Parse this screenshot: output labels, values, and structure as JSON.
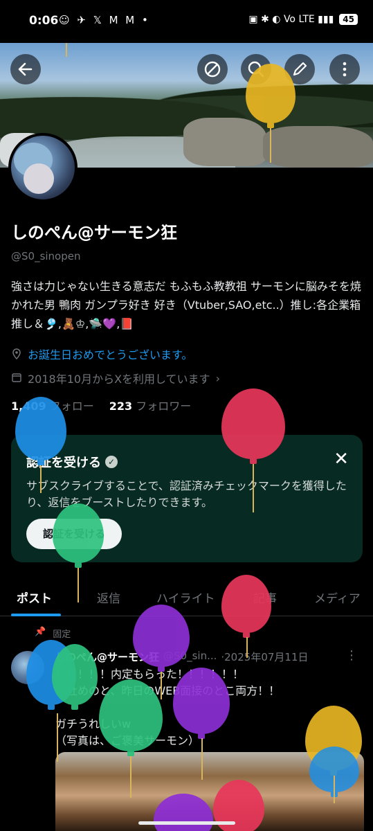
{
  "status_bar": {
    "time": "0:06",
    "left_icons": "☺ ✈ 𝕏 M M •",
    "right_icons": "▣ ✱ ◐ Vo LTE ▮▮▮",
    "battery": "45"
  },
  "header": {
    "back_icon": "back-arrow-icon",
    "actions": [
      "block-icon",
      "search-icon",
      "edit-icon",
      "more-vertical-icon"
    ]
  },
  "profile": {
    "display_name": "しのぺん@サーモン狂",
    "handle": "@S0_sinopen",
    "bio": "強さは力じゃない生きる意志だ もふもふ教教祖 サーモンに脳みそを焼かれた男 鴨肉 ガンプラ好き 好き（Vtuber,SAO,etc..）推し:各企業箱推し＆🎐,🧸♔,🛸💜,📕",
    "location": "お誕生日おめでとうございます。",
    "joined": "2018年10月からXを利用しています",
    "following_count": "1,409",
    "following_label": "フォロー",
    "followers_count": "223",
    "followers_label": "フォロワー"
  },
  "verify_card": {
    "title": "認証を受ける",
    "description": "サブスクライブすることで、認証済みチェックマークを獲得したり、返信をブーストしたりできます。",
    "button_label": "認証を受ける",
    "close_icon": "close-icon"
  },
  "tabs": [
    {
      "label": "ポスト",
      "active": true
    },
    {
      "label": "返信",
      "active": false
    },
    {
      "label": "ハイライト",
      "active": false
    },
    {
      "label": "記事",
      "active": false
    },
    {
      "label": "メディア",
      "active": false
    }
  ],
  "post": {
    "pinned_label": "固定",
    "author": "しのぺん@サーモン狂",
    "handle": "@S0_sin...",
    "date": "·2025年07月11日",
    "body": "！！！！！内定もらった！！！！！！\n一社めのと、昨日のWEB面接のとこ両方！！\n\nガチうれしいw\n（写真は、ご褒美サーモン）"
  },
  "colors": {
    "accent": "#1d9bf0",
    "card_bg": "#072a22",
    "balloon_red": "#e8365a",
    "balloon_blue": "#1e8fe6",
    "balloon_green": "#2ec27e",
    "balloon_purple": "#8d2fd6",
    "balloon_yellow": "#e8b623"
  }
}
